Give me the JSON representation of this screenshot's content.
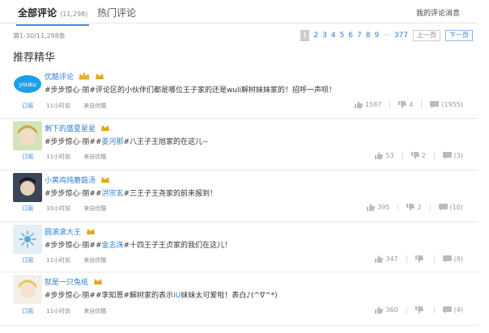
{
  "tabs": [
    {
      "label": "全部评论",
      "count": "(11,298)",
      "active": true
    },
    {
      "label": "热门评论",
      "count": "",
      "active": false
    }
  ],
  "my_messages": "我的评论消息",
  "range_text": "第1-30/11,298条",
  "pagination": {
    "pages": [
      "1",
      "2",
      "3",
      "4",
      "5",
      "6",
      "7",
      "8",
      "9"
    ],
    "ellipsis": "···",
    "last": "377",
    "prev": "上一页",
    "next": "下一页"
  },
  "section_title": "推荐精华",
  "comments": [
    {
      "username": "优酷评论",
      "pre": "#步步惊心·丽#评论区的小伙伴们都是哪位王子家的还是wuli解树妹妹家的！招呼一声呗！",
      "hl": "",
      "post": "",
      "subscribe": "订阅",
      "time": "11小时前",
      "source": "来自优酷",
      "likes": "1587",
      "dislikes": "4",
      "replies": "(1955)",
      "avatar_text": "youku"
    },
    {
      "username": "剩下的盛夏星星",
      "pre": "#步步惊心·丽##",
      "hl": "姜河那",
      "post": "#八王子王旭家的在这儿~",
      "subscribe": "订阅",
      "time": "11小时前",
      "source": "来自优酷",
      "likes": "53",
      "dislikes": "2",
      "replies": "(3)"
    },
    {
      "username": "小黄鸡炖蘑菇汤",
      "pre": "#步步惊心·丽##",
      "hl": "洪宗玄",
      "post": "#三王子王尧家的前来报到！",
      "subscribe": "订阅",
      "time": "10小时前",
      "source": "来自优酷",
      "likes": "395",
      "dislikes": "2",
      "replies": "(10)"
    },
    {
      "username": "圆滚滚大王",
      "pre": "#步步惊心·丽##",
      "hl": "金志洙",
      "post": "#十四王子王贞家的我们在这儿！",
      "subscribe": "订阅",
      "time": "11小时前",
      "source": "来自优酷",
      "likes": "347",
      "dislikes": "",
      "replies": "(9)"
    },
    {
      "username": "就是一只兔纸",
      "pre": "#步步惊心·丽##李知恩#解树家的表示",
      "hl": "IU",
      "post": "妹妹太可爱啦！表白♪(^∇^*)",
      "subscribe": "订阅",
      "time": "11小时前",
      "source": "来自优酷",
      "likes": "360",
      "dislikes": "",
      "replies": "(4)"
    }
  ],
  "colors": {
    "link": "#2d7fd3",
    "badge": "#e6a817",
    "tab_underline": "#3a8ee6"
  }
}
